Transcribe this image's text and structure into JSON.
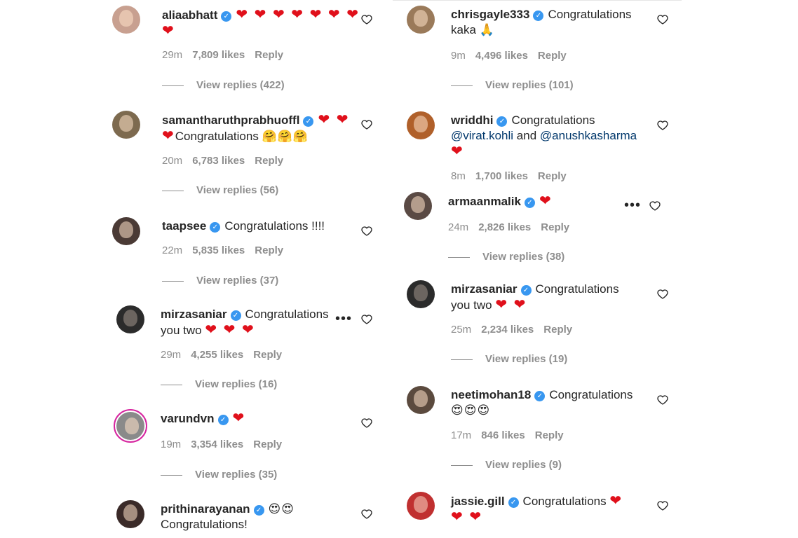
{
  "left": [
    {
      "user": "aliaabhatt",
      "text": "",
      "emoji_hearts": "❤ ❤ ❤ ❤  ❤ ❤ ❤ ❤",
      "emoji_faces": "",
      "time": "29m",
      "likes": "7,809 likes",
      "reply": "Reply",
      "view": "View replies (422)",
      "avatar_color": "#c8a090",
      "more": false
    },
    {
      "user": "samantharuthprabhuoffl",
      "text": "Congratulations",
      "emoji_hearts": "❤ ❤ ❤",
      "emoji_faces": "🤗🤗🤗",
      "time": "20m",
      "likes": "6,783 likes",
      "reply": "Reply",
      "view": "View replies (56)",
      "avatar_color": "#7d6a4f",
      "more": false
    },
    {
      "user": "taapsee",
      "text": "Congratulations !!!!",
      "emoji_hearts": "",
      "emoji_faces": "",
      "time": "22m",
      "likes": "5,835 likes",
      "reply": "Reply",
      "view": "View replies (37)",
      "avatar_color": "#4a3a35",
      "more": false
    },
    {
      "user": "mirzasaniar",
      "text": "Congratulations you two",
      "emoji_hearts": "❤ ❤ ❤",
      "emoji_faces": "",
      "time": "29m",
      "likes": "4,255 likes",
      "reply": "Reply",
      "view": "View replies (16)",
      "avatar_color": "#2b2b2b",
      "more": true
    },
    {
      "user": "varundvn",
      "text": "",
      "emoji_hearts": "❤",
      "emoji_faces": "",
      "time": "19m",
      "likes": "3,354 likes",
      "reply": "Reply",
      "view": "View replies (35)",
      "avatar_color": "#8a8a8a",
      "more": false
    },
    {
      "user": "prithinarayanan",
      "text": "Congratulations!",
      "emoji_hearts": "",
      "emoji_faces": "😍😍",
      "time": "",
      "likes": "",
      "reply": "",
      "view": "",
      "avatar_color": "#3a2a28",
      "more": false
    }
  ],
  "right": [
    {
      "user": "chrisgayle333",
      "text": "Congratulations kaka",
      "emoji_hearts": "",
      "emoji_faces": "🙏",
      "time": "9m",
      "likes": "4,496 likes",
      "reply": "Reply",
      "view": "View replies (101)",
      "avatar_color": "#9a7a5a",
      "more": false
    },
    {
      "user": "wriddhi",
      "text": "Congratulations",
      "mention1": "@virat.kohli",
      "and": "and",
      "mention2": "@anushkasharma",
      "emoji_hearts": "❤",
      "emoji_faces": "",
      "time": "8m",
      "likes": "1,700 likes",
      "reply": "Reply",
      "view": "",
      "avatar_color": "#b0602a",
      "more": false
    },
    {
      "user": "armaanmalik",
      "text": "",
      "emoji_hearts": "❤",
      "emoji_faces": "",
      "time": "24m",
      "likes": "2,826 likes",
      "reply": "Reply",
      "view": "View replies (38)",
      "avatar_color": "#5a4a44",
      "more": true
    },
    {
      "user": "mirzasaniar",
      "text": "Congratulations you two",
      "emoji_hearts": "❤ ❤",
      "emoji_faces": "",
      "time": "25m",
      "likes": "2,234 likes",
      "reply": "Reply",
      "view": "View replies (19)",
      "avatar_color": "#2b2b2b",
      "more": false
    },
    {
      "user": "neetimohan18",
      "text": "Congratulations",
      "emoji_hearts": "",
      "emoji_faces": "😍😍😍",
      "time": "17m",
      "likes": "846 likes",
      "reply": "Reply",
      "view": "View replies (9)",
      "avatar_color": "#5b4a3e",
      "more": false
    },
    {
      "user": "jassie.gill",
      "text": "Congratulations",
      "emoji_hearts": "❤ ❤ ❤",
      "emoji_faces": "",
      "time": "",
      "likes": "",
      "reply": "",
      "view": "",
      "avatar_color": "#c03030",
      "more": false
    }
  ]
}
